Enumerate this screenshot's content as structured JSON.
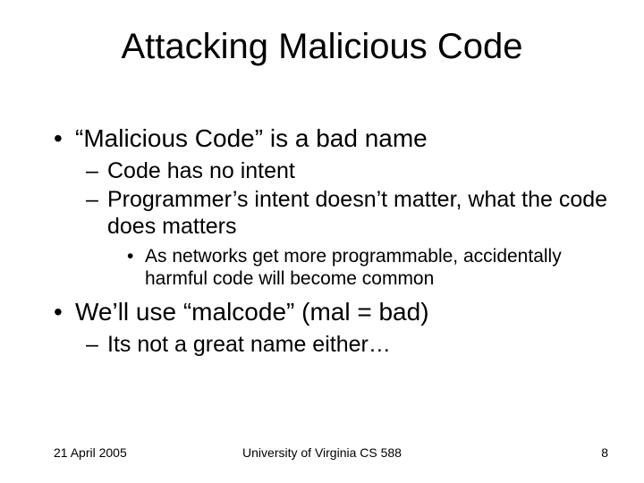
{
  "title": "Attacking Malicious Code",
  "bullets": {
    "b1": "“Malicious Code” is a bad name",
    "b1a": "Code has no intent",
    "b1b": "Programmer’s intent doesn’t matter, what the code does matters",
    "b1b1": "As networks get more programmable, accidentally harmful code will become common",
    "b2": "We’ll use “malcode” (mal = bad)",
    "b2a": "Its not a great name either…"
  },
  "footer": {
    "date": "21 April 2005",
    "center": "University of Virginia CS 588",
    "page": "8"
  }
}
